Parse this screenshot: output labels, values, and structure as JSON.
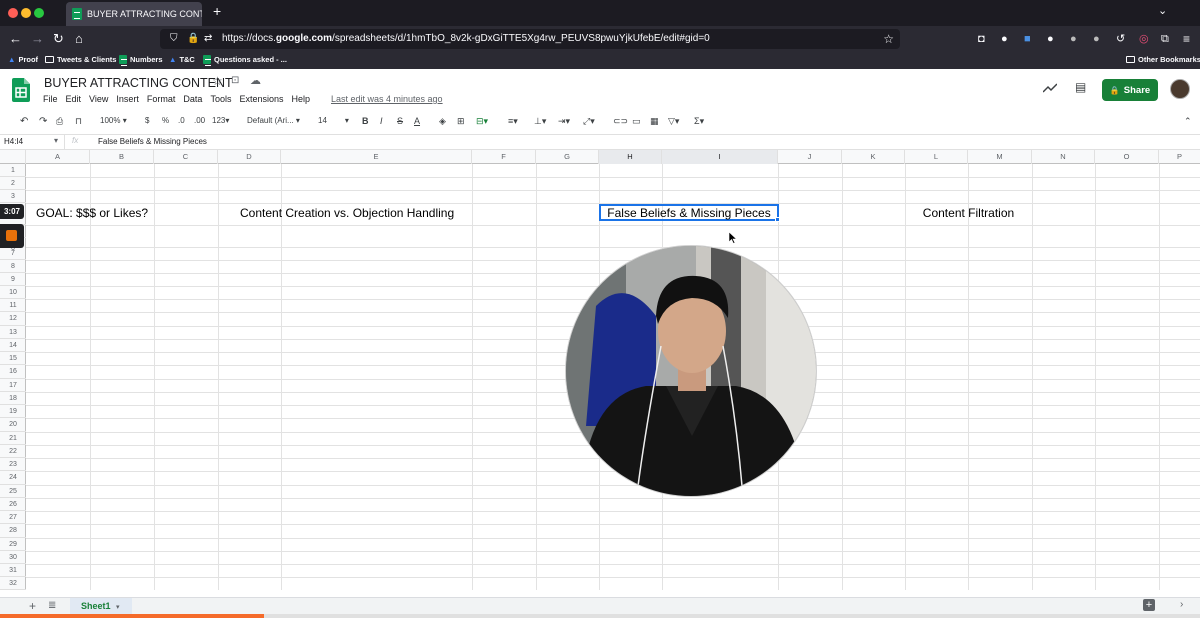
{
  "browser": {
    "tab_title": "BUYER ATTRACTING CONTENT",
    "url_prefix": "https://docs.",
    "url_domain": "google.com",
    "url_path": "/spreadsheets/d/1hmTbO_8v2k-gDxGiTTE5Xg4rw_PEUVS8pwuYjkUfebE/edit#gid=0",
    "bookmarks": [
      "Proof",
      "Tweets & Clients",
      "Numbers",
      "T&C",
      "Questions asked - ..."
    ],
    "other_bookmarks": "Other Bookmarks"
  },
  "sheet": {
    "title": "BUYER ATTRACTING CONTENT",
    "menu": [
      "File",
      "Edit",
      "View",
      "Insert",
      "Format",
      "Data",
      "Tools",
      "Extensions",
      "Help"
    ],
    "last_edit": "Last edit was 4 minutes ago",
    "share_label": "Share"
  },
  "toolbar": {
    "zoom": "100%",
    "currency": "$",
    "percent": "%",
    "decimal_less": ".0",
    "decimal_more": ".00",
    "format_more": "123",
    "font": "Default (Ari...",
    "font_size": "14",
    "bold": "B",
    "italic": "I",
    "strike": "S",
    "text_color": "A",
    "sum": "Σ"
  },
  "formula_bar": {
    "name_box": "H4:I4",
    "fx": "fx",
    "content": "False Beliefs & Missing Pieces"
  },
  "grid": {
    "columns": [
      "A",
      "B",
      "C",
      "D",
      "E",
      "F",
      "G",
      "H",
      "I",
      "J",
      "K",
      "L",
      "M",
      "N",
      "O",
      "P"
    ],
    "rows": [
      "1",
      "2",
      "3",
      "4",
      "5",
      "6",
      "7",
      "8",
      "9",
      "10",
      "11",
      "12",
      "13",
      "14",
      "15",
      "16",
      "17",
      "18",
      "19",
      "20",
      "21",
      "22",
      "23",
      "24",
      "25",
      "26",
      "27",
      "28",
      "29",
      "30",
      "31",
      "32"
    ],
    "cells": {
      "A4": "GOAL: $$$ or Likes?",
      "D4": "Content Creation vs. Objection Handling",
      "H4": "False Beliefs & Missing Pieces",
      "L4": "Content Filtration"
    }
  },
  "recording": {
    "timer": "3:07",
    "progress": 0.22
  },
  "bottom": {
    "sheet_tab": "Sheet1"
  },
  "colors": {
    "sheets_green": "#188038",
    "selection_blue": "#1a73e8",
    "recording_orange": "#f56b2a"
  }
}
